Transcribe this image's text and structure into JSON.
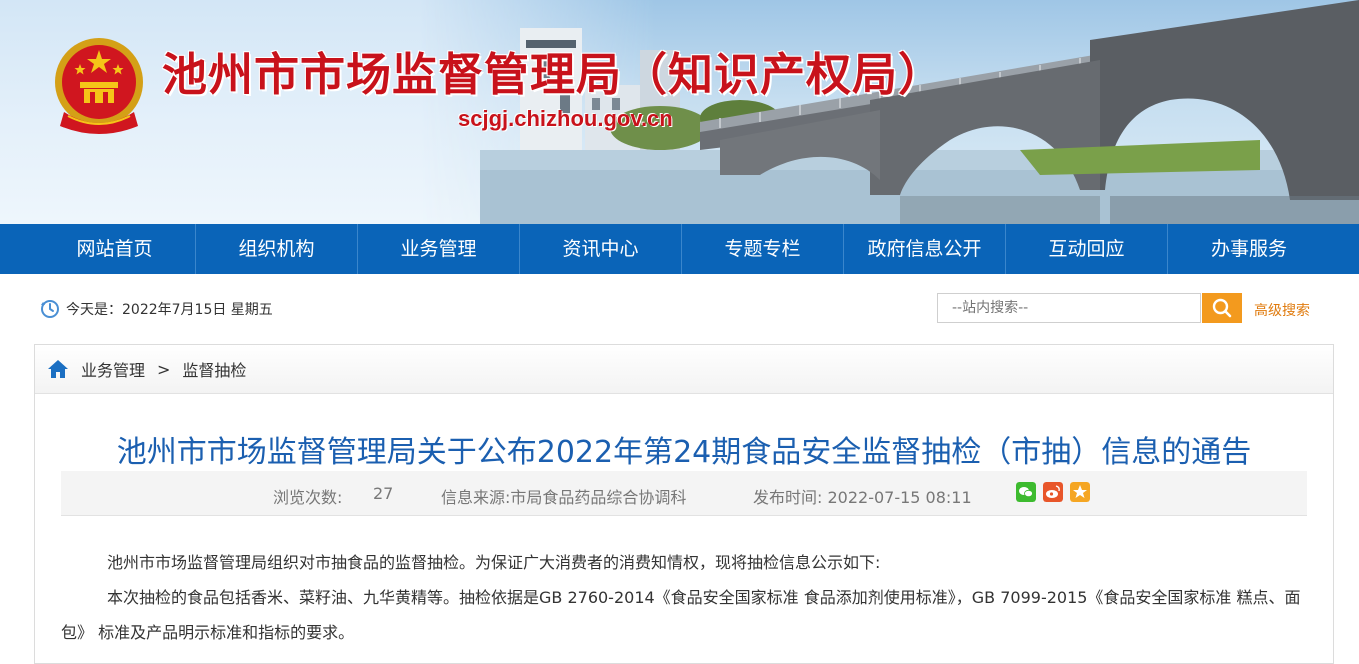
{
  "header": {
    "site_title": "池州市市场监督管理局（知识产权局）",
    "domain": "scjgj.chizhou.gov.cn"
  },
  "nav": {
    "items": [
      {
        "label": "网站首页"
      },
      {
        "label": "组织机构"
      },
      {
        "label": "业务管理"
      },
      {
        "label": "资讯中心"
      },
      {
        "label": "专题专栏"
      },
      {
        "label": "政府信息公开"
      },
      {
        "label": "互动回应"
      },
      {
        "label": "办事服务"
      }
    ]
  },
  "infobar": {
    "date_text": "今天是：2022年7月15日 星期五",
    "search_placeholder": "--站内搜索--",
    "advanced_search": "高级搜索"
  },
  "breadcrumb": {
    "items": [
      "业务管理",
      "监督抽检"
    ],
    "separator": ">"
  },
  "article": {
    "title": "池州市市场监督管理局关于公布2022年第24期食品安全监督抽检（市抽）信息的通告",
    "views_label": "浏览次数:",
    "views_value": "27",
    "source": "信息来源:市局食品药品综合协调科",
    "published": "发布时间: 2022-07-15 08:11",
    "paragraphs": [
      "池州市市场监督管理局组织对市抽食品的监督抽检。为保证广大消费者的消费知情权，现将抽检信息公示如下:",
      "本次抽检的食品包括香米、菜籽油、九华黄精等。抽检依据是GB 2760-2014《食品安全国家标准 食品添加剂使用标准》，GB 7099-2015《食品安全国家标准 糕点、面包》 标准及产品明示标准和指标的要求。"
    ]
  },
  "share": [
    {
      "name": "wechat-icon",
      "color": "#3dbb2f"
    },
    {
      "name": "weibo-icon",
      "color": "#e8562a"
    },
    {
      "name": "qzone-icon",
      "color": "#f5a623"
    }
  ],
  "colors": {
    "nav_bg": "#0a64b8",
    "title_red": "#c8121b",
    "article_title_blue": "#1b5fb0",
    "search_orange": "#f39a1e"
  }
}
